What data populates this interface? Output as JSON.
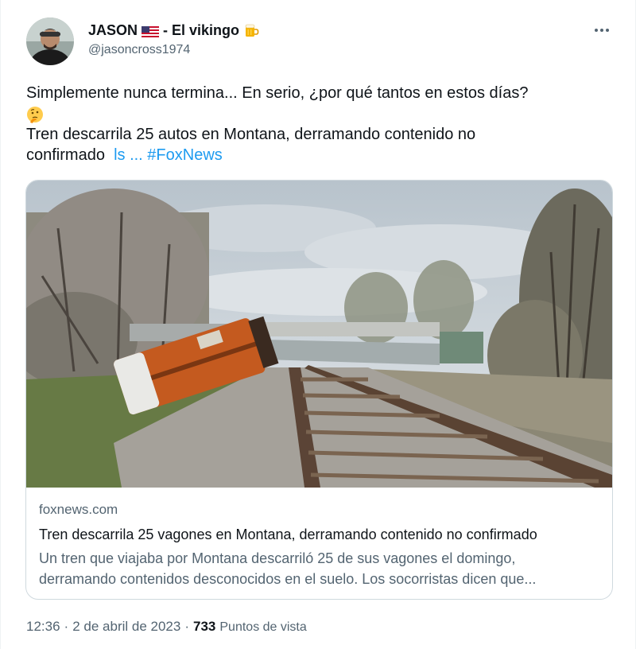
{
  "author": {
    "name": "JASON",
    "name_suffix": "- El vikingo",
    "handle": "@jasoncross1974",
    "flag_icon": "us-flag-icon",
    "emoji_icon": "beer-mug-icon"
  },
  "tweet": {
    "line1": "Simplemente nunca termina... En serio, ¿por qué tantos en estos días?",
    "emoji_icon": "thinking-face-icon",
    "line3": "Tren descarrila 25 autos en Montana, derramando contenido no",
    "line4_text": "confirmado",
    "line4_link": "ls ...",
    "hashtag": "#FoxNews"
  },
  "card": {
    "domain": "foxnews.com",
    "title": "Tren descarrila 25 vagones en Montana, derramando contenido no confirmado",
    "desc_line1": "Un tren que viajaba por Montana descarriló 25 de sus vagones el domingo,",
    "desc_line2": "derramando contenidos desconocidos en el suelo. Los socorristas dicen que..."
  },
  "footer": {
    "time": "12:36",
    "separator": "·",
    "date": "2 de abril de 2023",
    "views_count": "733",
    "views_label": "Puntos de vista"
  },
  "colors": {
    "link": "#1d9bf0",
    "secondary_text": "#536471",
    "primary_text": "#0f1419",
    "border": "#cfd9de"
  }
}
